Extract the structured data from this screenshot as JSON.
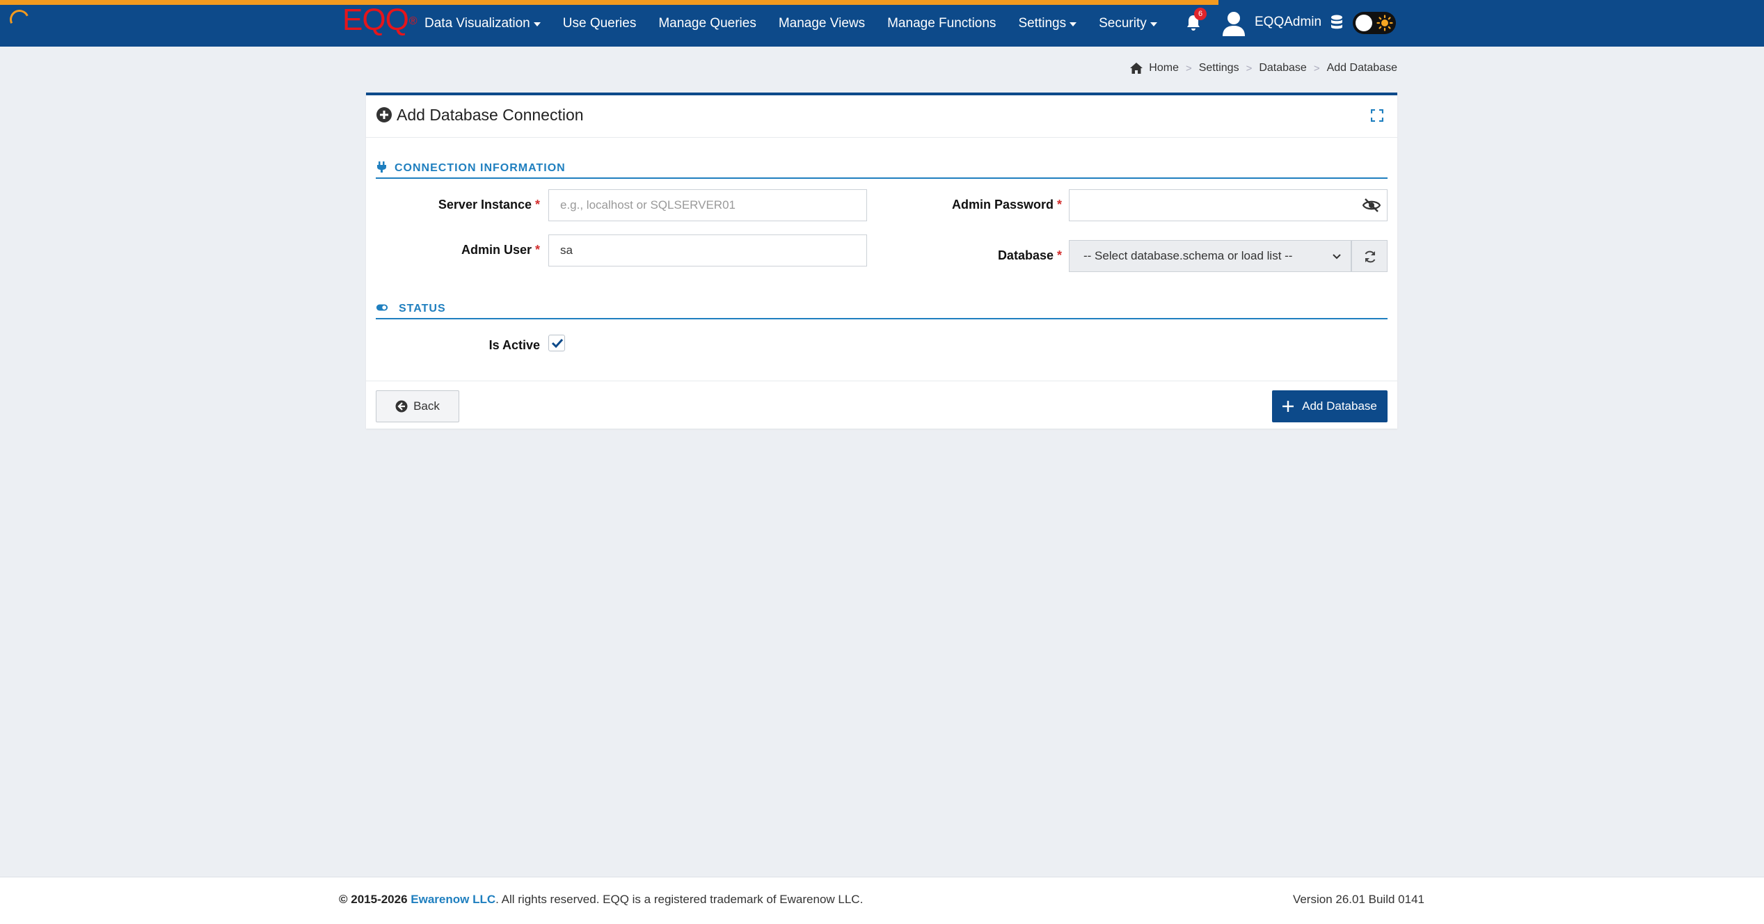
{
  "navbar": {
    "brand": "EQQ",
    "brand_mark": "®",
    "menu": [
      {
        "label": "Data Visualization",
        "dropdown": true
      },
      {
        "label": "Use Queries",
        "dropdown": false
      },
      {
        "label": "Manage Queries",
        "dropdown": false
      },
      {
        "label": "Manage Views",
        "dropdown": false
      },
      {
        "label": "Manage Functions",
        "dropdown": false
      },
      {
        "label": "Settings",
        "dropdown": true
      },
      {
        "label": "Security",
        "dropdown": true
      }
    ],
    "notification_count": "6",
    "user_name": "EQQAdmin",
    "colors": {
      "bar": "#0d4a8a",
      "progress": "#f29a1f",
      "brand": "#e6151b"
    }
  },
  "breadcrumb": [
    "Home",
    "Settings",
    "Database",
    "Add Database"
  ],
  "card": {
    "title": "Add Database Connection",
    "sections": {
      "connection": "CONNECTION INFORMATION",
      "status": "STATUS"
    },
    "fields": {
      "server_instance": {
        "label": "Server Instance",
        "required": "*",
        "value": "",
        "placeholder": "e.g., localhost or SQLSERVER01"
      },
      "admin_user": {
        "label": "Admin User",
        "required": "*",
        "value": "sa"
      },
      "admin_password": {
        "label": "Admin Password",
        "required": "*",
        "value": ""
      },
      "database": {
        "label": "Database",
        "required": "*",
        "selected": "-- Select database.schema or load list --"
      },
      "is_active": {
        "label": "Is Active",
        "checked": true
      }
    },
    "buttons": {
      "back": "Back",
      "add": "Add Database"
    },
    "accent": "#1f7fbf"
  },
  "footer": {
    "copyright_prefix": "© 2015-2026",
    "company": "Ewarenow LLC",
    "copyright_suffix": ". All rights reserved. EQQ is a registered trademark of Ewarenow LLC.",
    "version": "Version 26.01 Build 0141"
  }
}
